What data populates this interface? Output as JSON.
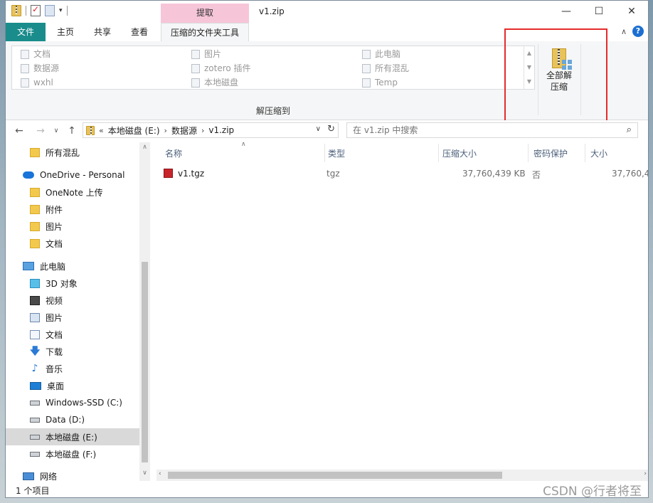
{
  "titlebar": {
    "window_title": "v1.zip",
    "context_tab": "提取",
    "qat_dropdown": "▾",
    "buttons": {
      "minimize": "—",
      "maximize": "☐",
      "close": "✕"
    }
  },
  "tabs": {
    "file": "文件",
    "home": "主页",
    "share": "共享",
    "view": "查看",
    "compressed_tools": "压缩的文件夹工具",
    "collapse": "∧",
    "help": "?"
  },
  "ribbon": {
    "gallery": [
      {
        "label": "文档",
        "icon": "document-icon"
      },
      {
        "label": "数据源",
        "icon": "folder-icon"
      },
      {
        "label": "wxhl",
        "icon": "folder-icon"
      },
      {
        "label": "图片",
        "icon": "pictures-icon"
      },
      {
        "label": "zotero 插件",
        "icon": "folder-icon"
      },
      {
        "label": "本地磁盘",
        "icon": "drive-icon"
      },
      {
        "label": "此电脑",
        "icon": "computer-icon"
      },
      {
        "label": "所有混乱",
        "icon": "folder-icon"
      },
      {
        "label": "Temp",
        "icon": "folder-icon"
      }
    ],
    "group_label": "解压缩到",
    "extract_all_line1": "全部解",
    "extract_all_line2": "压缩"
  },
  "address": {
    "prefix": "«",
    "crumbs": [
      "本地磁盘 (E:)",
      "数据源",
      "v1.zip"
    ],
    "search_placeholder": "在 v1.zip 中搜索"
  },
  "navpane": [
    {
      "label": "所有混乱",
      "icon": "folder-icon",
      "indent": 1
    },
    {
      "label": "OneDrive - Personal",
      "icon": "onedrive-cloud-icon",
      "indent": 0
    },
    {
      "label": "OneNote 上传",
      "icon": "folder-icon",
      "indent": 1
    },
    {
      "label": "附件",
      "icon": "folder-icon",
      "indent": 1
    },
    {
      "label": "图片",
      "icon": "folder-icon",
      "indent": 1
    },
    {
      "label": "文档",
      "icon": "folder-icon",
      "indent": 1
    },
    {
      "label": "此电脑",
      "icon": "computer-icon",
      "indent": 0
    },
    {
      "label": "3D 对象",
      "icon": "3d-objects-icon",
      "indent": 1
    },
    {
      "label": "视频",
      "icon": "video-icon",
      "indent": 1
    },
    {
      "label": "图片",
      "icon": "pictures-icon",
      "indent": 1
    },
    {
      "label": "文档",
      "icon": "documents-icon",
      "indent": 1
    },
    {
      "label": "下载",
      "icon": "download-icon",
      "indent": 1
    },
    {
      "label": "音乐",
      "icon": "music-icon",
      "indent": 1
    },
    {
      "label": "桌面",
      "icon": "desktop-icon",
      "indent": 1
    },
    {
      "label": "Windows-SSD (C:)",
      "icon": "drive-icon",
      "indent": 1
    },
    {
      "label": "Data (D:)",
      "icon": "drive-icon",
      "indent": 1
    },
    {
      "label": "本地磁盘 (E:)",
      "icon": "drive-icon",
      "indent": 1,
      "selected": true
    },
    {
      "label": "本地磁盘 (F:)",
      "icon": "drive-icon",
      "indent": 1
    },
    {
      "label": "网络",
      "icon": "network-icon",
      "indent": 0
    }
  ],
  "columns": {
    "name": "名称",
    "type": "类型",
    "compressed_size": "压缩大小",
    "password": "密码保护",
    "size": "大小"
  },
  "files": [
    {
      "name": "v1.tgz",
      "type": "tgz",
      "compressed_size": "37,760,439 KB",
      "password": "否",
      "size": "37,760,4"
    }
  ],
  "status": {
    "count": "1 个项目"
  },
  "watermark": "CSDN @行者将至"
}
